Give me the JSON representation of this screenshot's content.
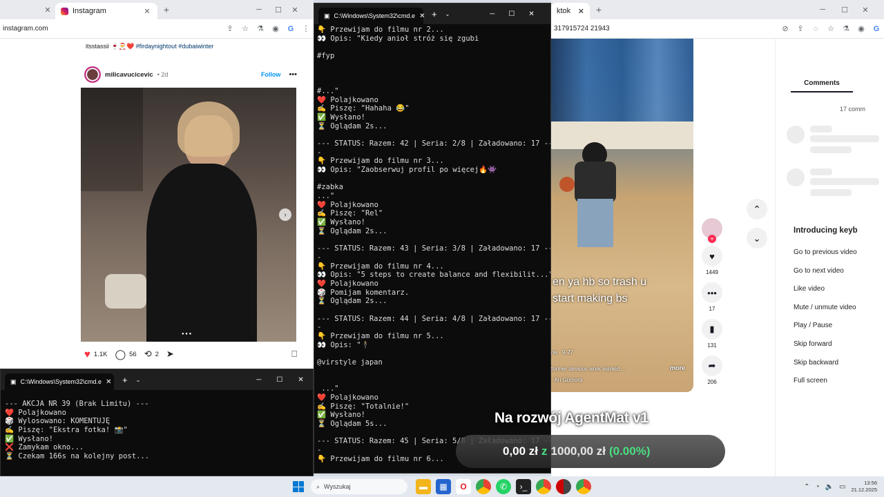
{
  "left_browser": {
    "tab_title": "Instagram",
    "url": "instagram.com",
    "caption_user": "itsstassii",
    "caption_tags": "🍷🎅❤️ #firdaynightout #dubaiwinter",
    "post_user": "milicavucicevic",
    "post_time": "• 2d",
    "follow_label": "Follow",
    "likes": "1.1K",
    "comments": "56",
    "reposts": "2"
  },
  "console_small": {
    "title": "C:\\Windows\\System32\\cmd.e",
    "lines": [
      "--- AKCJA NR 39 (Brak Limitu) ---",
      "❤️ Polajkowano",
      "🎲 Wylosowano: KOMENTUJĘ",
      "✍️ Piszę: \"Ekstra fotka! 📸\"",
      "✅ Wysłano!",
      "❌ Zamykam okno...",
      "⏳ Czekam 166s na kolejny post..."
    ]
  },
  "console_main": {
    "title": "C:\\Windows\\System32\\cmd.e",
    "lines": [
      "👇 Przewijam do filmu nr 2...",
      "👀 Opis: \"Kiedy anioł stróż się zgubi",
      "",
      "#fyp",
      "",
      "",
      "",
      "#...\"",
      "❤️ Polajkowano",
      "✍️ Piszę: \"Hahaha 😂\"",
      "✅ Wysłano!",
      "⏳ Oglądam 2s...",
      "",
      "--- STATUS: Razem: 42 | Seria: 2/8 | Załadowano: 17 ---",
      "-",
      "👇 Przewijam do filmu nr 3...",
      "👀 Opis: \"Zaobserwuj profil po więcej🔥👾",
      "",
      "#zabka",
      "...\"",
      "❤️ Polajkowano",
      "✍️ Piszę: \"Rel\"",
      "✅ Wysłano!",
      "⏳ Oglądam 2s...",
      "",
      "--- STATUS: Razem: 43 | Seria: 3/8 | Załadowano: 17 ---",
      "-",
      "👇 Przewijam do filmu nr 4...",
      "👀 Opis: \"5 steps to create balance and flexibilit...\"",
      "❤️ Polajkowano",
      "🎲 Pomijam komentarz.",
      "⏳ Oglądam 2s...",
      "",
      "--- STATUS: Razem: 44 | Seria: 4/8 | Załadowano: 17 ---",
      "-",
      "👇 Przewijam do filmu nr 5...",
      "👀 Opis: \"🕴",
      "",
      "@virstyle japan",
      "",
      "",
      " ...\"",
      "❤️ Polajkowano",
      "✍️ Piszę: \"Totalnie!\"",
      "✅ Wysłano!",
      "⏳ Oglądam 5s...",
      "",
      "--- STATUS: Razem: 45 | Seria: 5/8 | Załadowano: 17 ---",
      "-",
      "👇 Przewijam do filmu nr 6..."
    ]
  },
  "right_browser": {
    "url_partial": "317915724 21943",
    "tab_partial": "ktok",
    "comments_tab": "Comments",
    "comments_count": "17 comm",
    "keyboard_title": "Introducing keyb",
    "shortcuts": [
      "Go to previous video",
      "Go to next video",
      "Like video",
      "Mute / unmute video",
      "Play / Pause",
      "Skip forward",
      "Skip backward",
      "Full screen"
    ],
    "video_caption_1": "en ya hb so trash u",
    "video_caption_2": "start making bs",
    "video_desc": "former devious work #sinkid ...",
    "video_more": "more",
    "video_date": "ne · 9-27",
    "video_author": "· Ari Gumora",
    "likes": "1449",
    "comments": "17",
    "saves": "131",
    "shares": "206"
  },
  "overlay": {
    "title": "Na rozwój AgentMat v1",
    "current": "0,00 zł",
    "separator": "z",
    "goal": "1000,00 zł",
    "percent": "(0.00%)"
  },
  "taskbar": {
    "search_placeholder": "Wyszukaj",
    "time": "13:56",
    "date": "21.12.2025"
  }
}
